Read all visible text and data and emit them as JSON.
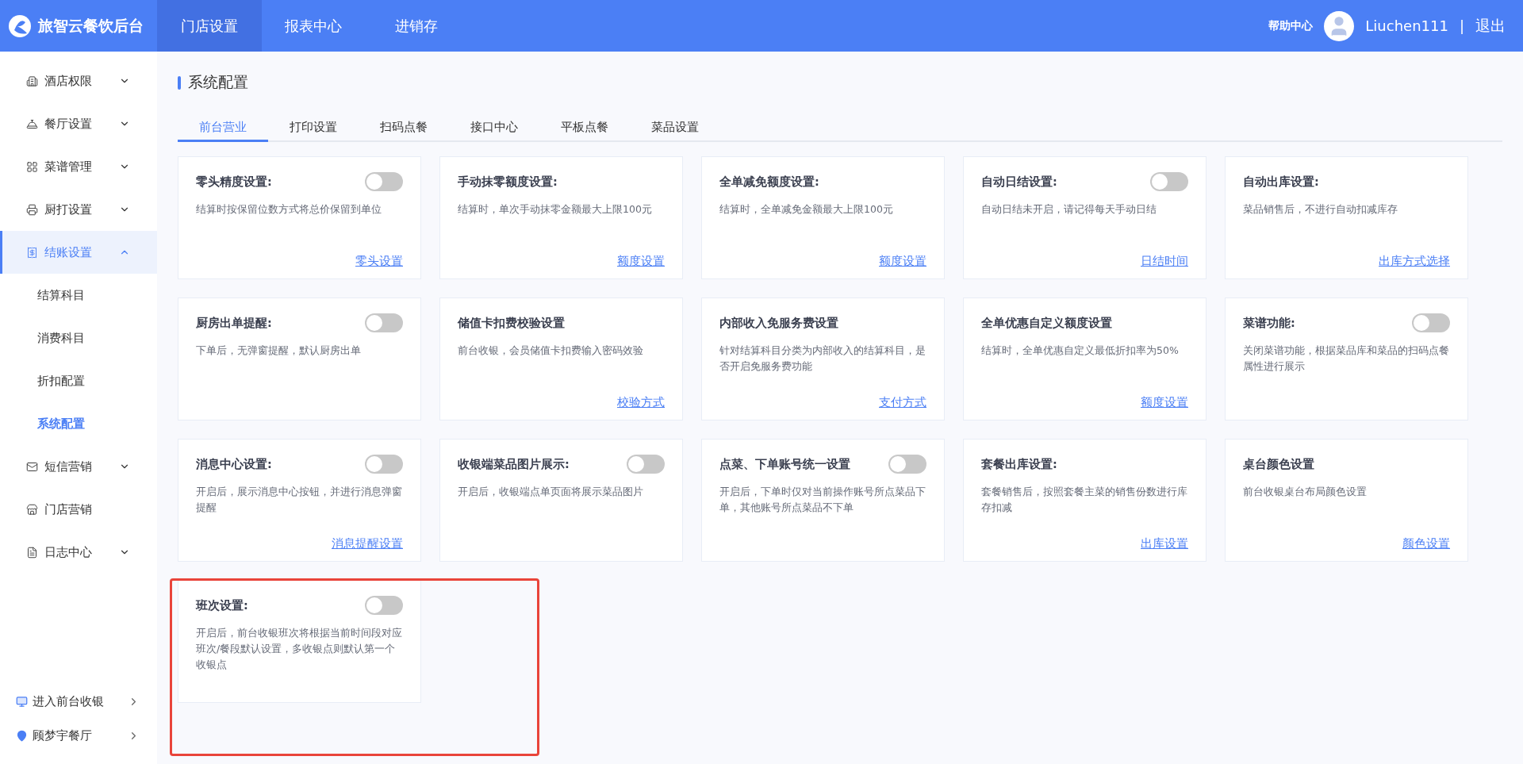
{
  "topbar": {
    "brand": "旅智云餐饮后台",
    "nav": [
      {
        "label": "门店设置",
        "selected": true
      },
      {
        "label": "报表中心",
        "selected": false
      },
      {
        "label": "进销存",
        "selected": false
      }
    ],
    "help": "帮助中心",
    "user": "Liuchen111",
    "separator": "|",
    "logout": "退出"
  },
  "sidebar": {
    "items": [
      {
        "label": "酒店权限",
        "expanded": false,
        "selected": false
      },
      {
        "label": "餐厅设置",
        "expanded": false,
        "selected": false
      },
      {
        "label": "菜谱管理",
        "expanded": false,
        "selected": false
      },
      {
        "label": "厨打设置",
        "expanded": false,
        "selected": false
      },
      {
        "label": "结账设置",
        "expanded": true,
        "selected": true,
        "children": [
          {
            "label": "结算科目",
            "selected": false
          },
          {
            "label": "消费科目",
            "selected": false
          },
          {
            "label": "折扣配置",
            "selected": false
          },
          {
            "label": "系统配置",
            "selected": true
          }
        ]
      },
      {
        "label": "短信营销",
        "expanded": false,
        "selected": false
      },
      {
        "label": "门店营销",
        "selected": false
      },
      {
        "label": "日志中心",
        "expanded": false,
        "selected": false
      }
    ],
    "bottom_links": [
      {
        "label": "进入前台收银"
      },
      {
        "label": "顾梦宇餐厅"
      }
    ]
  },
  "page_title": "系统配置",
  "tabs": [
    {
      "label": "前台营业",
      "selected": true
    },
    {
      "label": "打印设置",
      "selected": false
    },
    {
      "label": "扫码点餐",
      "selected": false
    },
    {
      "label": "接口中心",
      "selected": false
    },
    {
      "label": "平板点餐",
      "selected": false
    },
    {
      "label": "菜品设置",
      "selected": false
    }
  ],
  "cards": [
    {
      "title": "零头精度设置:",
      "on": false,
      "description": "结算时按保留位数方式将总价保留到单位",
      "link": "零头设置"
    },
    {
      "title": "手动抹零额度设置:",
      "description": "结算时，单次手动抹零金额最大上限100元",
      "link": "额度设置"
    },
    {
      "title": "全单减免额度设置:",
      "description": "结算时，全单减免金额最大上限100元",
      "link": "额度设置"
    },
    {
      "title": "自动日结设置:",
      "on": false,
      "description": "自动日结未开启，请记得每天手动日结",
      "link": "日结时间"
    },
    {
      "title": "自动出库设置:",
      "description": "菜品销售后，不进行自动扣减库存",
      "link": "出库方式选择"
    },
    {
      "title": "厨房出单提醒:",
      "on": false,
      "description": "下单后，无弹窗提醒，默认厨房出单"
    },
    {
      "title": "储值卡扣费校验设置",
      "description": "前台收银，会员储值卡扣费输入密码效验",
      "link": "校验方式"
    },
    {
      "title": "内部收入免服务费设置",
      "description": "针对结算科目分类为内部收入的结算科目，是否开启免服务费功能",
      "link": "支付方式"
    },
    {
      "title": "全单优惠自定义额度设置",
      "description": "结算时，全单优惠自定义最低折扣率为50%",
      "link": "额度设置"
    },
    {
      "title": "菜谱功能:",
      "on": false,
      "description": "关闭菜谱功能，根据菜品库和菜品的扫码点餐属性进行展示"
    },
    {
      "title": "消息中心设置:",
      "on": false,
      "description": "开启后，展示消息中心按钮，并进行消息弹窗提醒",
      "link": "消息提醒设置"
    },
    {
      "title": "收银端菜品图片展示:",
      "on": false,
      "description": "开启后，收银端点单页面将展示菜品图片"
    },
    {
      "title": "点菜、下单账号统一设置",
      "on": false,
      "description": "开启后，下单时仅对当前操作账号所点菜品下单，其他账号所点菜品不下单"
    },
    {
      "title": "套餐出库设置:",
      "description": "套餐销售后，按照套餐主菜的销售份数进行库存扣减",
      "link": "出库设置"
    },
    {
      "title": "桌台颜色设置",
      "description": "前台收银桌台布局颜色设置",
      "link": "颜色设置"
    },
    {
      "title": "班次设置:",
      "on": false,
      "highlighted": true,
      "description": "开启后，前台收银班次将根据当前时间段对应班次/餐段默认设置，多收银点则默认第一个收银点"
    }
  ]
}
